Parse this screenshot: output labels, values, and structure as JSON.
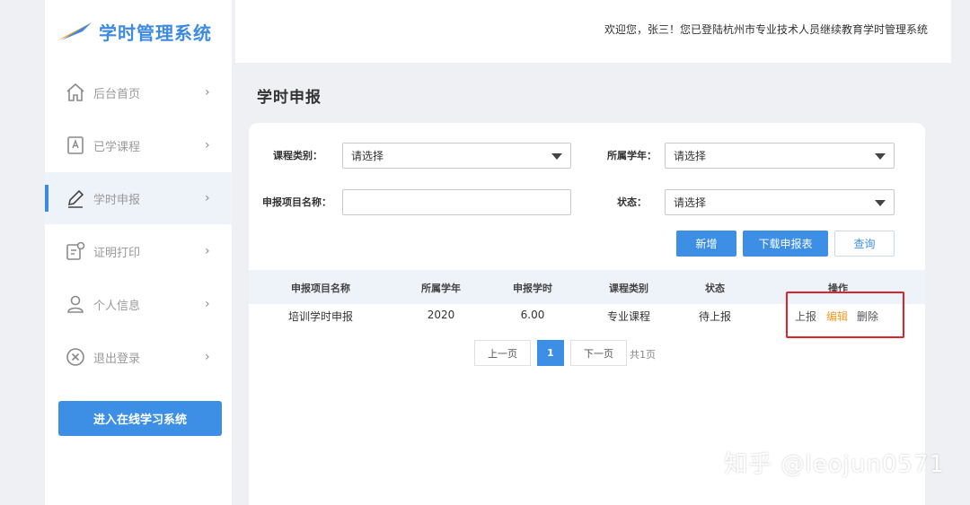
{
  "app": {
    "logo_text": "学时管理系统"
  },
  "header": {
    "welcome": "欢迎您，张三！您已登陆杭州市专业技术人员继续教育学时管理系统"
  },
  "sidebar": {
    "items": [
      {
        "label": "后台首页",
        "icon": "home-icon",
        "arrow": "›"
      },
      {
        "label": "已学课程",
        "icon": "book-icon",
        "arrow": "›"
      },
      {
        "label": "学时申报",
        "icon": "edit-icon",
        "arrow": "›",
        "active": true
      },
      {
        "label": "证明打印",
        "icon": "certificate-icon",
        "arrow": "›"
      },
      {
        "label": "个人信息",
        "icon": "user-icon",
        "arrow": "›"
      },
      {
        "label": "退出登录",
        "icon": "close-circle-icon",
        "arrow": "›"
      }
    ],
    "enter_button": "进入在线学习系统"
  },
  "page": {
    "title": "学时申报"
  },
  "form": {
    "course_type_label": "课程类别：",
    "course_type_value": "请选择",
    "year_label": "所属学年：",
    "year_value": "请选择",
    "project_name_label": "申报项目名称：",
    "project_name_value": "",
    "status_label": "状态：",
    "status_value": "请选择"
  },
  "actions": {
    "add": "新增",
    "download": "下载申报表",
    "query": "查询"
  },
  "table": {
    "headers": [
      "申报项目名称",
      "所属学年",
      "申报学时",
      "课程类别",
      "状态",
      "操作"
    ],
    "rows": [
      {
        "name": "培训学时申报",
        "year": "2020",
        "hours": "6.00",
        "type": "专业课程",
        "status": "待上报",
        "ops": {
          "report": "上报",
          "edit": "编辑",
          "delete": "删除"
        }
      }
    ]
  },
  "pagination": {
    "prev": "上一页",
    "current": "1",
    "next": "下一页",
    "total": "共1页"
  },
  "watermark": "知乎 @leojun0571",
  "colors": {
    "accent": "#3d8fe6",
    "edit_link": "#f39a1e",
    "highlight": "#e0222a"
  }
}
